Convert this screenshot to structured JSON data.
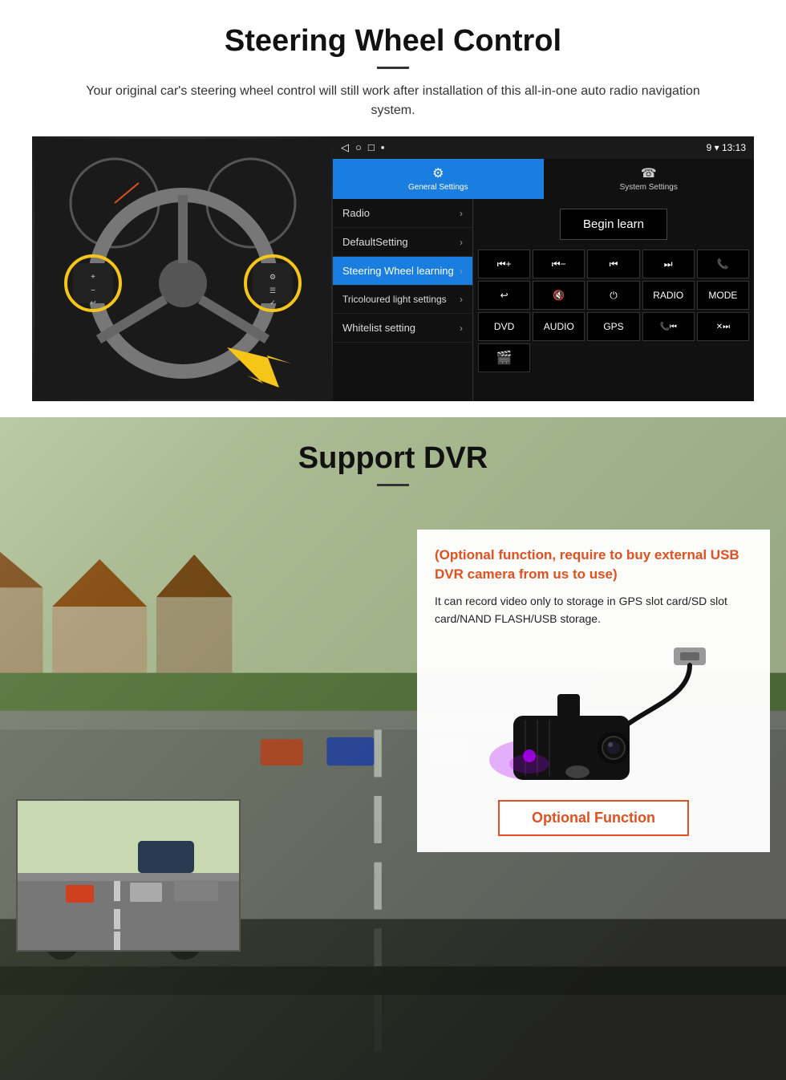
{
  "section1": {
    "title": "Steering Wheel Control",
    "subtitle": "Your original car's steering wheel control will still work after installation of this all-in-one auto radio navigation system.",
    "android": {
      "statusbar": {
        "icons": [
          "◁",
          "○",
          "□",
          "▪"
        ],
        "right": "9 ▾ 13:13"
      },
      "tabs": [
        {
          "icon": "⚙",
          "label": "General Settings",
          "active": true
        },
        {
          "icon": "☎",
          "label": "System Settings",
          "active": false
        }
      ],
      "menu_items": [
        {
          "label": "Radio",
          "active": false
        },
        {
          "label": "DefaultSetting",
          "active": false
        },
        {
          "label": "Steering Wheel learning",
          "active": true
        },
        {
          "label": "Tricoloured light settings",
          "active": false
        },
        {
          "label": "Whitelist setting",
          "active": false
        }
      ],
      "begin_learn": "Begin learn",
      "control_buttons": [
        "⏮+",
        "⏮—",
        "⏮|",
        "|⏭",
        "📞",
        "↩",
        "🔇×",
        "⏻",
        "RADIO",
        "MODE",
        "DVD",
        "AUDIO",
        "GPS",
        "📞⏮",
        "✕⏭",
        "🎬"
      ]
    }
  },
  "section2": {
    "title": "Support DVR",
    "card": {
      "optional_text": "(Optional function, require to buy external USB DVR camera from us to use)",
      "description": "It can record video only to storage in GPS slot card/SD slot card/NAND FLASH/USB storage.",
      "optional_function_btn": "Optional Function"
    }
  }
}
